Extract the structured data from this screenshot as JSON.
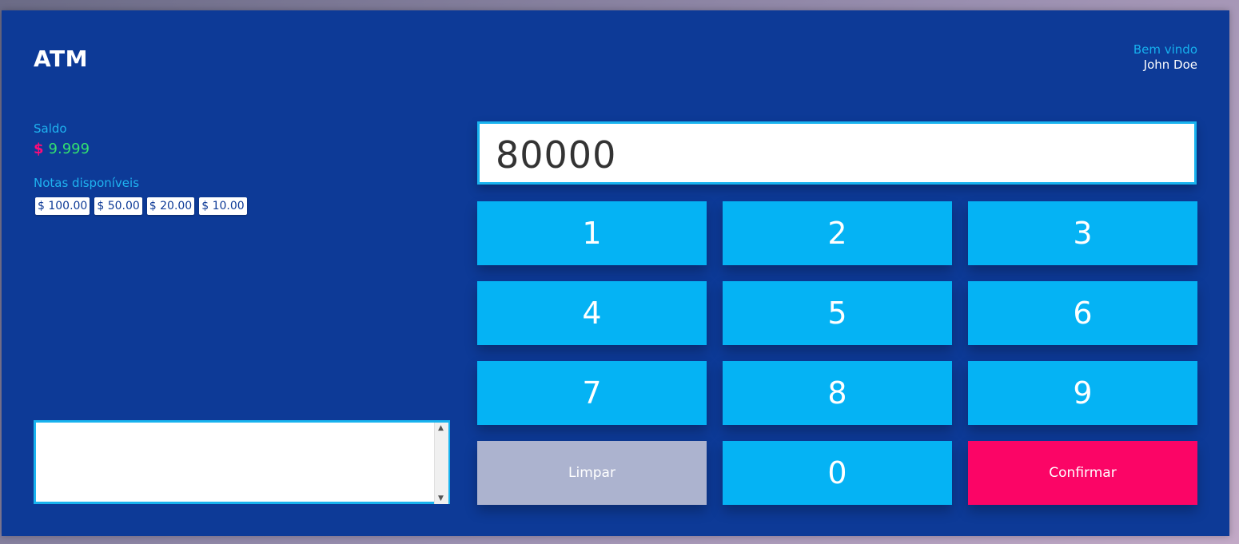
{
  "header": {
    "logo": "ATM",
    "welcome": "Bem vindo",
    "user": "John Doe"
  },
  "account": {
    "balance_label": "Saldo",
    "currency": "$",
    "balance": "9.999",
    "notes_label": "Notas disponíveis",
    "notes": [
      "$ 100.00",
      "$ 50.00",
      "$ 20.00",
      "$ 10.00"
    ]
  },
  "log": {
    "value": ""
  },
  "display": {
    "value": "80000"
  },
  "keypad": {
    "k1": "1",
    "k2": "2",
    "k3": "3",
    "k4": "4",
    "k5": "5",
    "k6": "6",
    "k7": "7",
    "k8": "8",
    "k9": "9",
    "clear": "Limpar",
    "k0": "0",
    "confirm": "Confirmar"
  },
  "colors": {
    "background": "#0d3a97",
    "key": "#05b3f4",
    "clear": "#acb3cf",
    "confirm": "#fb0566",
    "accent": "#1fb3f0",
    "balance": "#33e070"
  }
}
